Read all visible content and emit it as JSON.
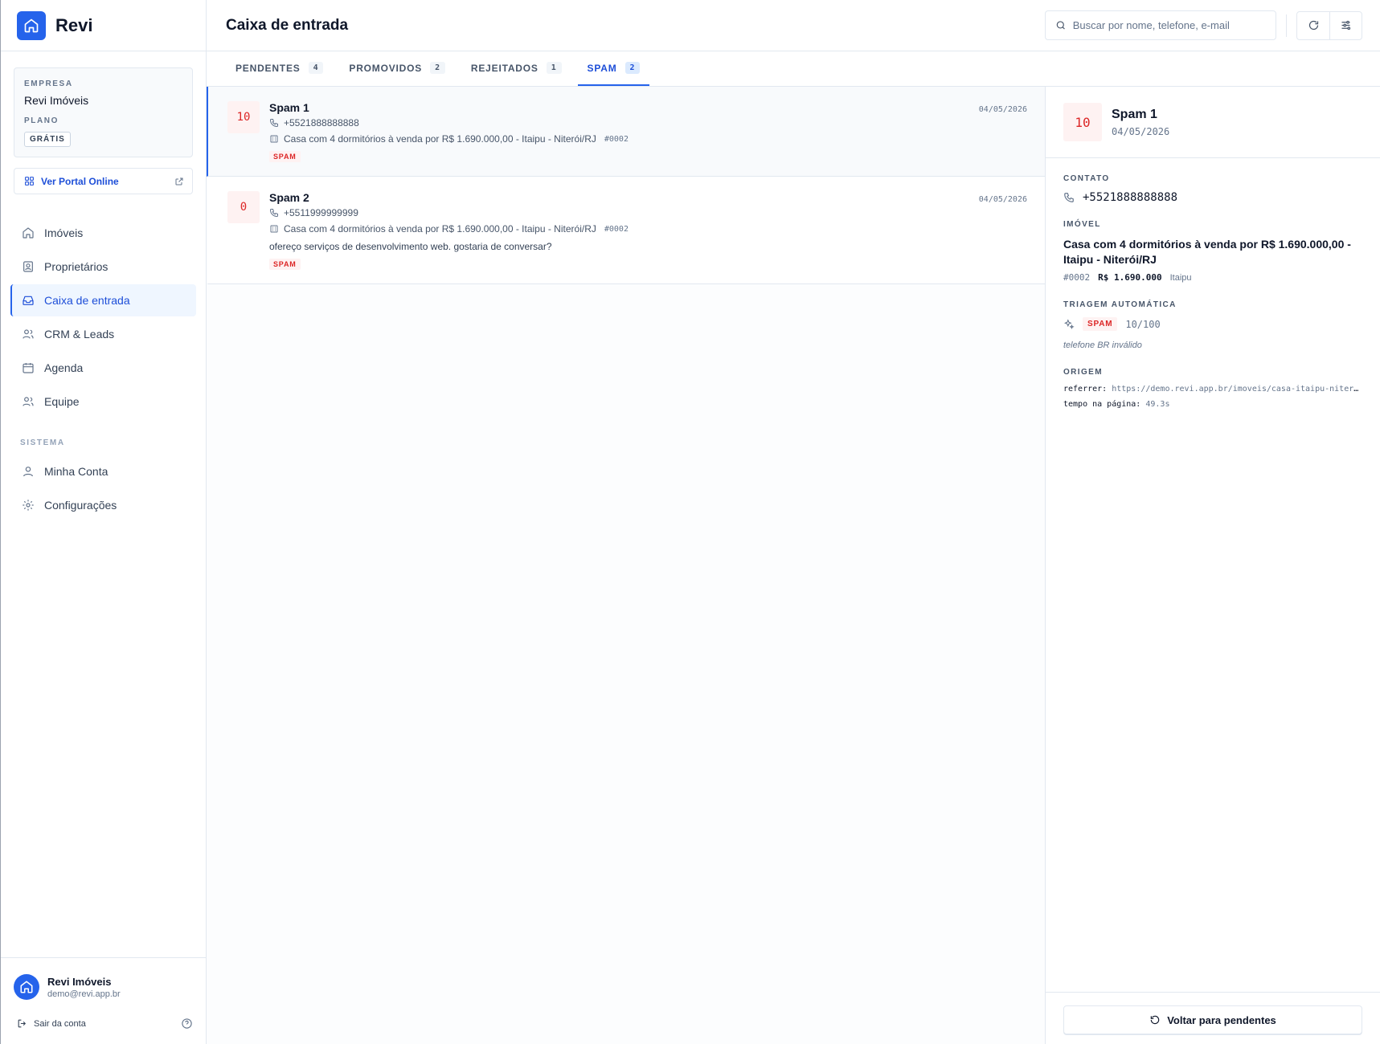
{
  "brand": {
    "name": "Revi"
  },
  "company": {
    "label": "EMPRESA",
    "name": "Revi Imóveis",
    "plan_label": "PLANO",
    "plan": "GRÁTIS"
  },
  "portal": {
    "label": "Ver Portal Online"
  },
  "nav": {
    "items": [
      {
        "label": "Imóveis",
        "icon": "home-icon"
      },
      {
        "label": "Proprietários",
        "icon": "contact-card-icon"
      },
      {
        "label": "Caixa de entrada",
        "icon": "inbox-icon",
        "active": true
      },
      {
        "label": "CRM & Leads",
        "icon": "users-icon"
      },
      {
        "label": "Agenda",
        "icon": "calendar-icon"
      },
      {
        "label": "Equipe",
        "icon": "team-icon"
      }
    ],
    "system_label": "SISTEMA",
    "system_items": [
      {
        "label": "Minha Conta",
        "icon": "user-icon"
      },
      {
        "label": "Configurações",
        "icon": "gear-icon"
      }
    ]
  },
  "user": {
    "name": "Revi Imóveis",
    "email": "demo@revi.app.br",
    "logout": "Sair da conta"
  },
  "header": {
    "title": "Caixa de entrada",
    "search_placeholder": "Buscar por nome, telefone, e-mail"
  },
  "tabs": [
    {
      "label": "PENDENTES",
      "count": "4"
    },
    {
      "label": "PROMOVIDOS",
      "count": "2"
    },
    {
      "label": "REJEITADOS",
      "count": "1"
    },
    {
      "label": "SPAM",
      "count": "2",
      "active": true
    }
  ],
  "leads": [
    {
      "score": "10",
      "name": "Spam 1",
      "date": "04/05/2026",
      "phone": "+5521888888888",
      "property": "Casa com 4 dormitórios à venda por R$ 1.690.000,00 - Itaipu - Niterói/RJ",
      "code": "#0002",
      "message": "",
      "badge": "SPAM"
    },
    {
      "score": "0",
      "name": "Spam 2",
      "date": "04/05/2026",
      "phone": "+5511999999999",
      "property": "Casa com 4 dormitórios à venda por R$ 1.690.000,00 - Itaipu - Niterói/RJ",
      "code": "#0002",
      "message": "ofereço serviços de desenvolvimento web. gostaria de conversar?",
      "badge": "SPAM"
    }
  ],
  "detail": {
    "score": "10",
    "name": "Spam 1",
    "date": "04/05/2026",
    "contact_label": "CONTATO",
    "phone": "+5521888888888",
    "property_label": "IMÓVEL",
    "property_title": "Casa com 4 dormitórios à venda por R$ 1.690.000,00 - Itaipu - Niterói/RJ",
    "property_code": "#0002",
    "property_price": "R$ 1.690.000",
    "property_area": "Itaipu",
    "triage_label": "TRIAGEM AUTOMÁTICA",
    "triage_badge": "SPAM",
    "triage_score": "10/100",
    "triage_reason": "telefone BR inválido",
    "origin_label": "ORIGEM",
    "referrer_key": "referrer:",
    "referrer_value": "https://demo.revi.app.br/imoveis/casa-itaipu-niteroi",
    "time_key": "tempo na página:",
    "time_value": "49.3s",
    "back_label": "Voltar para pendentes"
  },
  "colors": {
    "accent": "#2563eb",
    "spam": "#dc2626",
    "spam_bg": "#fef2f2"
  }
}
